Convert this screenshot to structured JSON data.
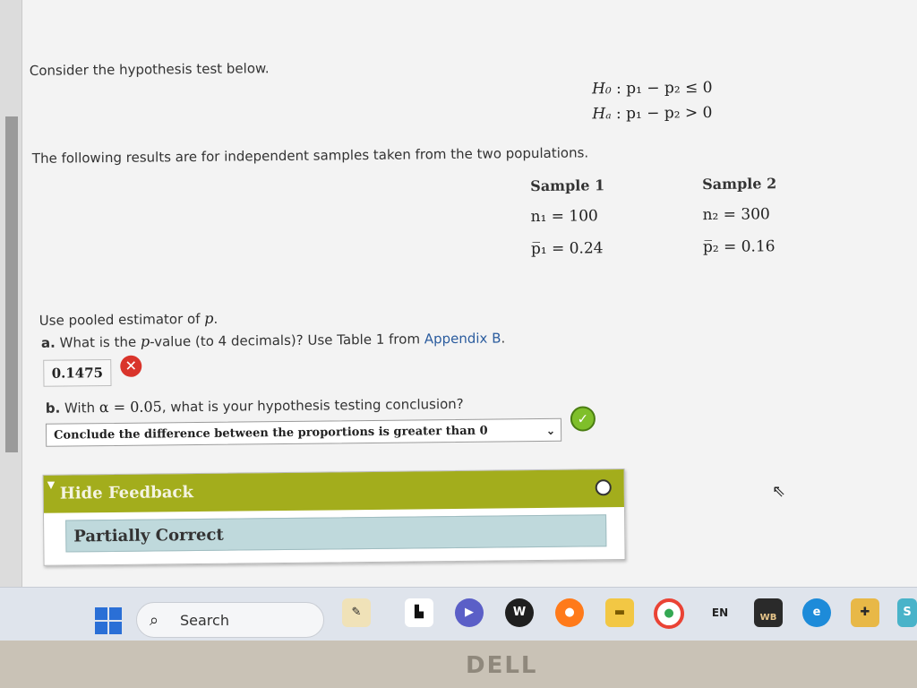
{
  "question": {
    "intro": "Consider the hypothesis test below.",
    "h0": {
      "label": "H₀",
      "expr": ": p₁ − p₂ ≤ 0"
    },
    "ha": {
      "label": "Hₐ",
      "expr": ": p₁ − p₂ > 0"
    },
    "results_text": "The following results are for independent samples taken from the two populations.",
    "sample1": {
      "header": "Sample 1",
      "n": "n₁ = 100",
      "p": "p̅₁ = 0.24"
    },
    "sample2": {
      "header": "Sample 2",
      "n": "n₂ = 300",
      "p": "p̅₂ = 0.16"
    },
    "pooled_prefix": "Use pooled estimator of ",
    "pooled_var": "p",
    "pooled_suffix": ".",
    "part_a": {
      "letter": "a.",
      "text_before": " What is the ",
      "pvar": "p",
      "text_after": "-value (to 4 decimals)? Use Table 1 from ",
      "link": "Appendix B",
      "end": ".",
      "answer": "0.1475",
      "status": "incorrect"
    },
    "part_b": {
      "letter": "b.",
      "text_before": " With ",
      "alpha": "α = 0.05",
      "text_after": ", what is your hypothesis testing conclusion?",
      "selected": "Conclude the difference between the proportions is greater than 0",
      "status": "correct"
    }
  },
  "feedback": {
    "toggle_label": "Hide Feedback",
    "result": "Partially Correct"
  },
  "taskbar": {
    "search_label": "Search",
    "lang": "EN",
    "wb_label": "WB",
    "apps": [
      "start-icon",
      "widgets-icon",
      "file-icon",
      "teams-icon",
      "w-app-icon",
      "firefox-icon",
      "file-explorer-icon",
      "chrome-icon",
      "edge-icon",
      "tools-icon"
    ]
  },
  "bezel": {
    "brand": "DELL"
  },
  "colors": {
    "feedback_header": "#a3ad1c",
    "partially_bg": "#bfd9dc",
    "incorrect": "#d9342b",
    "correct": "#7fbf2a",
    "link": "#2b5c9e"
  }
}
